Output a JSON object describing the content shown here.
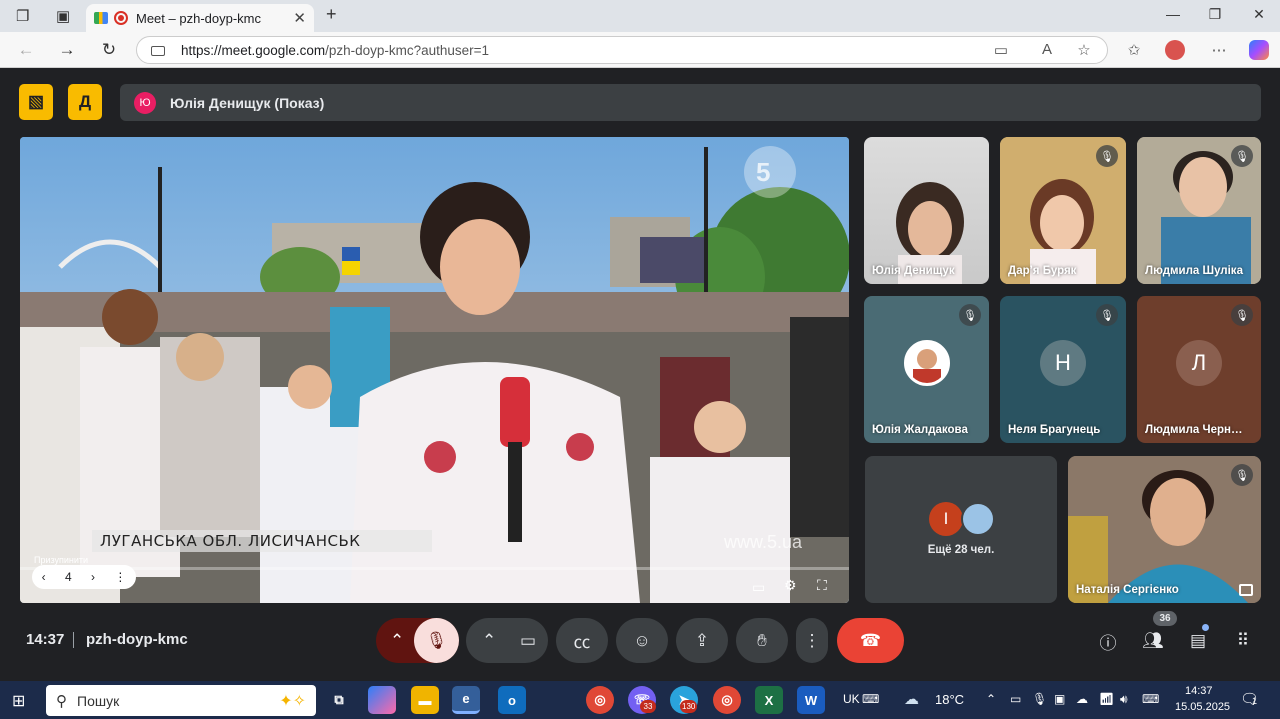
{
  "browser": {
    "tab_title": "Meet – pzh-doyp-kmc",
    "url_host": "https://meet.google.com",
    "url_path": "/pzh-doyp-kmc?authuser=1"
  },
  "presentation": {
    "presenter_initial": "Ю",
    "presenter_label": "Юлія Денищук (Показ)"
  },
  "main_video": {
    "caption": "ЛУГАНСЬКА ОБЛ. ЛИСИЧАНСЬК",
    "watermark": "www.5.ua",
    "channel_logo": "5",
    "pause_label": "Призупинити",
    "page_number": "4"
  },
  "participants": [
    {
      "name": "Юлія Денищук",
      "muted": false
    },
    {
      "name": "Дарʼя Буряк",
      "muted": true
    },
    {
      "name": "Людмила Шуліка",
      "muted": true
    },
    {
      "name": "Юлія Жалдакова",
      "muted": true
    },
    {
      "name": "Неля Брагунець",
      "initial": "Н",
      "muted": true
    },
    {
      "name": "Людмила Черн…",
      "initial": "Л",
      "muted": true
    },
    {
      "name": "Наталія Сергієнко",
      "muted": true
    }
  ],
  "others": {
    "initial": "І",
    "label": "Ещё 28 чел."
  },
  "bottom_bar": {
    "time": "14:37",
    "meeting_code": "pzh-doyp-kmc",
    "people_count": "36"
  },
  "taskbar": {
    "search_placeholder": "Пошук",
    "lang": "UK",
    "weather": "18°C",
    "time": "14:37",
    "date": "15.05.2025",
    "badge_viber": "33",
    "badge_telegram": "130",
    "notification_count": "1"
  },
  "colors": {
    "meet_bg": "#202124",
    "presenter_yellow": "#f9bb00",
    "end_call_red": "#ea4335",
    "mute_red": "#f9dedc"
  }
}
